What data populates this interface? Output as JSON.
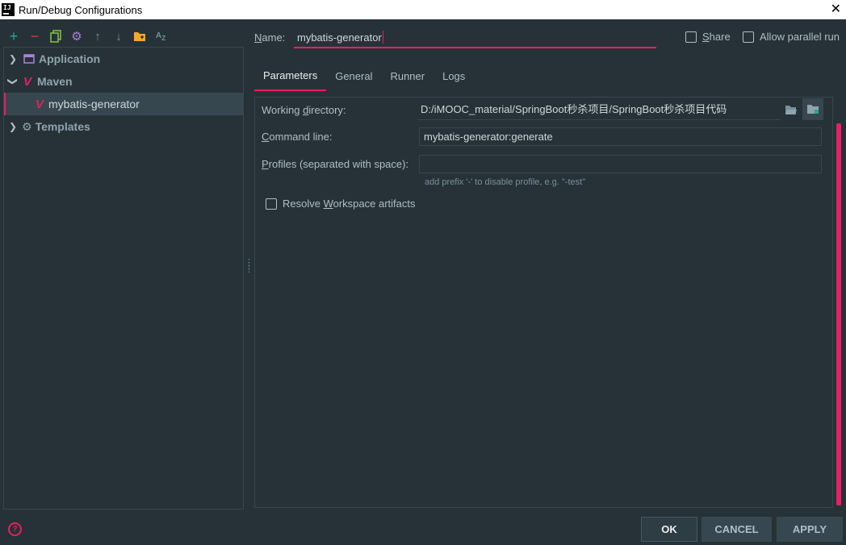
{
  "window": {
    "title": "Run/Debug Configurations"
  },
  "toolbar": {
    "buttons": [
      {
        "name": "add-icon",
        "glyph": "+",
        "color": "#26a69a"
      },
      {
        "name": "remove-icon",
        "glyph": "−",
        "color": "#e53935"
      },
      {
        "name": "copy-icon",
        "glyph": "⧉",
        "color": "#8bc34a"
      },
      {
        "name": "gear-icon",
        "glyph": "⚙",
        "color": "#ab82d9"
      },
      {
        "name": "arrow-up-icon",
        "glyph": "↑",
        "color": "#78909c"
      },
      {
        "name": "arrow-down-icon",
        "glyph": "↓",
        "color": "#78909c"
      },
      {
        "name": "new-folder-icon",
        "glyph": "▰",
        "color": "#f9a825"
      },
      {
        "name": "sort-az-icon",
        "glyph": "AZ",
        "color": "#78909c"
      }
    ]
  },
  "tree": {
    "application": {
      "label": "Application",
      "icon": "application-icon"
    },
    "maven": {
      "label": "Maven",
      "icon": "maven-icon"
    },
    "config": {
      "label": "mybatis-generator",
      "icon": "maven-icon"
    },
    "templates": {
      "label": "Templates",
      "icon": "gear-icon"
    }
  },
  "name_row": {
    "label_prefix": "N",
    "label_rest": "ame:",
    "value": "mybatis-generator"
  },
  "checkboxes": {
    "share": {
      "label_u": "S",
      "label_rest": "hare",
      "checked": false
    },
    "parallel": {
      "label": "Allow parallel run",
      "checked": false
    }
  },
  "tabs": [
    {
      "label": "Parameters",
      "active": true
    },
    {
      "label": "General",
      "active": false
    },
    {
      "label": "Runner",
      "active": false
    },
    {
      "label": "Logs",
      "active": false
    }
  ],
  "params": {
    "working_dir": {
      "label_a": "Working ",
      "label_u": "d",
      "label_b": "irectory:",
      "value": "D:/iMOOC_material/SpringBoot秒杀项目/SpringBoot秒杀项目代码"
    },
    "command_line": {
      "label_u": "C",
      "label_rest": "ommand line:",
      "value": "mybatis-generator:generate"
    },
    "profiles": {
      "label_u": "P",
      "label_rest": "rofiles (separated with space):",
      "value": "",
      "hint": "add prefix '-' to disable profile, e.g. \"-test\""
    },
    "resolve": {
      "label_a": "Resolve ",
      "label_u": "W",
      "label_b": "orkspace artifacts",
      "checked": false
    }
  },
  "buttons": {
    "ok": "OK",
    "cancel": "CANCEL",
    "apply": "APPLY"
  },
  "colors": {
    "background": "#263238",
    "accent": "#e91e63",
    "panel_border": "#37474f",
    "selected_row": "#37474f"
  }
}
